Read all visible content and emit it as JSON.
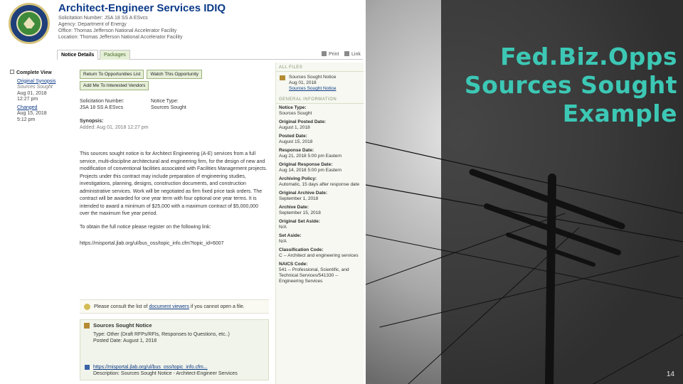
{
  "slide": {
    "title_lines": [
      "Fed.Biz.Opps",
      "Sources Sought",
      "Example"
    ],
    "page_number": "14",
    "accent": "#3cc8b5"
  },
  "notice": {
    "title": "Architect-Engineer Services IDIQ",
    "solicitation_line": "Solicitation Number: JSA 18 SS A ESvcs",
    "agency_line": "Agency: Department of Energy",
    "office_line": "Office: Thomas Jefferson National Accelerator Facility",
    "location_line": "Location: Thomas Jefferson National Accelerator Facility"
  },
  "tabs": {
    "details": "Notice Details",
    "packages": "Packages",
    "print": "Print",
    "link": "Link"
  },
  "history": {
    "heading": "Complete View",
    "items": [
      {
        "label": "Original Synopsis",
        "type": "Sources Sought",
        "date": "Aug 01, 2018",
        "time": "12:27 pm"
      },
      {
        "label": "Changed",
        "date": "Aug 15, 2018",
        "time": "5:12 pm"
      }
    ]
  },
  "buttons": {
    "return": "Return To Opportunities List",
    "watch": "Watch This Opportunity",
    "add_me": "Add Me To Interested Vendors"
  },
  "details": {
    "sol_label": "Solicitation Number:",
    "sol_value": "JSA 18 SS A ESvcs",
    "type_label": "Notice Type:",
    "type_value": "Sources Sought",
    "synopsis_label": "Synopsis:",
    "synopsis_added": "Added: Aug 01, 2018 12:27 pm",
    "body": "This sources sought notice is for Architect Engineering (A-E) services from a full service, multi-discipline architectural and engineering firm, for the design of new and modification of conventional facilities associated with Facilities Management projects. Projects under this contract may include preparation of engineering studies, investigations, planning, designs, construction documents, and construction administrative services. Work will be negotiated as firm fixed price task orders. The contract will be awarded for one year term with four optional one year terms. It is intended to award a minimum of $25,000 with a maximum contract of $5,000,000 over the maximum five year period.",
    "instructions": "To obtain the full notice please register on the following link:",
    "url": "https://misportal.jlab.org/ul/bus_oss/topic_info.cfm?topic_id=6007"
  },
  "viewer_note": {
    "before": "Please consult the list of ",
    "link": "document viewers",
    "after": " if you cannot open a file."
  },
  "package": {
    "heading": "Sources Sought Notice",
    "type_line": "Type: Other (Draft RFPs/RFIs, Responses to Questions, etc..)",
    "posted_line": "Posted Date: August 1, 2018",
    "file_link": "https://misportal.jlab.org/ul/bus_oss/topic_info.cfm...",
    "description_line": "Description: Sources Sought Notice - Architect-Engineer Services"
  },
  "side": {
    "all_files_heading": "ALL FILES",
    "file_title": "Sources Sought Notice",
    "file_date": "Aug 01, 2018",
    "file_link": "Sources Sought Notice",
    "general_heading": "GENERAL INFORMATION",
    "items": [
      {
        "label": "Notice Type:",
        "value": "Sources Sought"
      },
      {
        "label": "Original Posted Date:",
        "value": "August 1, 2018"
      },
      {
        "label": "Posted Date:",
        "value": "August 15, 2018"
      },
      {
        "label": "Response Date:",
        "value": "Aug 21, 2018 5:00 pm Eastern"
      },
      {
        "label": "Original Response Date:",
        "value": "Aug 14, 2018 5:00 pm Eastern"
      },
      {
        "label": "Archiving Policy:",
        "value": "Automatic, 15 days after response date"
      },
      {
        "label": "Original Archive Date:",
        "value": "September 1, 2018"
      },
      {
        "label": "Archive Date:",
        "value": "September 15, 2018"
      },
      {
        "label": "Original Set Aside:",
        "value": "N/A"
      },
      {
        "label": "Set Aside:",
        "value": "N/A"
      },
      {
        "label": "Classification Code:",
        "value": "C -- Architect and engineering services"
      },
      {
        "label": "NAICS Code:",
        "value": "541 -- Professional, Scientific, and Technical Services/541330 -- Engineering Services"
      }
    ]
  }
}
